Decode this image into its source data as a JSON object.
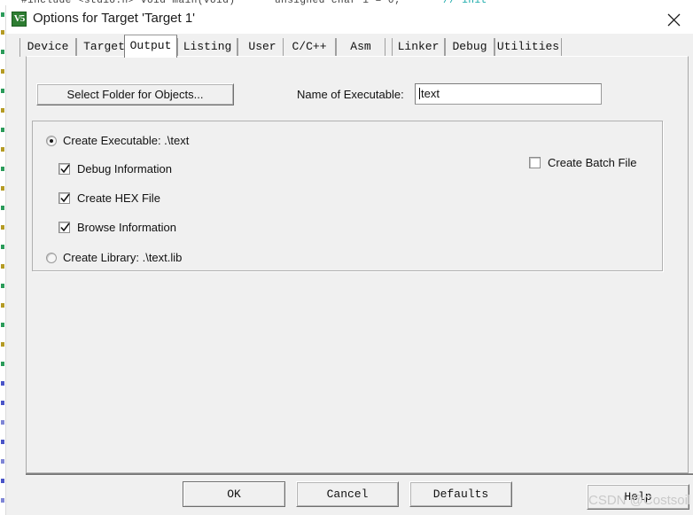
{
  "window": {
    "title": "Options for Target 'Target 1'",
    "icon_label": "V5",
    "icon_name": "keil-uvision-icon",
    "close_icon": "close-icon"
  },
  "tabs": [
    {
      "label": "Device",
      "active": false
    },
    {
      "label": "Target",
      "active": false
    },
    {
      "label": "Output",
      "active": true
    },
    {
      "label": "Listing",
      "active": false
    },
    {
      "label": "User",
      "active": false
    },
    {
      "label": "C/C++",
      "active": false
    },
    {
      "label": "Asm",
      "active": false
    },
    {
      "label": "Linker",
      "active": false
    },
    {
      "label": "Debug",
      "active": false
    },
    {
      "label": "Utilities",
      "active": false
    }
  ],
  "output_page": {
    "select_folder_button": "Select Folder for Objects...",
    "name_of_executable_label": "Name of Executable:",
    "name_of_executable_value": "text",
    "name_of_executable_placeholder": "",
    "create_executable": {
      "label": "Create Executable:  .\\text",
      "checked": true
    },
    "debug_information": {
      "label": "Debug Information",
      "checked": true
    },
    "create_hex_file": {
      "label": "Create HEX File",
      "checked": true
    },
    "browse_information": {
      "label": "Browse Information",
      "checked": true
    },
    "create_library": {
      "label": "Create Library:  .\\text.lib",
      "checked": false
    },
    "create_batch_file": {
      "label": "Create Batch File",
      "checked": false
    }
  },
  "footer": {
    "ok": "OK",
    "cancel": "Cancel",
    "defaults": "Defaults",
    "help": "Help"
  },
  "watermark": "CSDN @Costsoil",
  "colors": {
    "dialog_bg": "#f0f0f0",
    "titlebar_bg": "#ffffff",
    "active_tab_bg": "#ffffff",
    "border": "#a0a0a0",
    "text": "#111111",
    "icon_green": "#2e7d32",
    "watermark_gray": "#c9c9c9"
  }
}
